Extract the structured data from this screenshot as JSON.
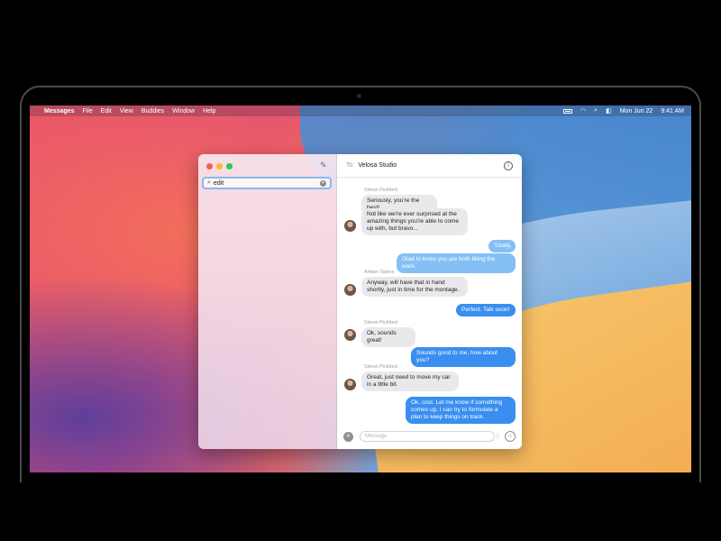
{
  "menubar": {
    "app": "Messages",
    "items": [
      "File",
      "Edit",
      "View",
      "Buddies",
      "Window",
      "Help"
    ],
    "date": "Mon Jun 22",
    "time": "9:41 AM"
  },
  "sidebar": {
    "search_value": "edit"
  },
  "chat": {
    "to_label": "To:",
    "recipient": "Velosa Studio",
    "placeholder": "Message",
    "messages": [
      {
        "sender": "Simon Pickford",
        "text": "Seriously, you're the best!"
      },
      {
        "text": "Not like we're ever surprised at the amazing things you're able to come up with, but bravo..."
      },
      {
        "text": "Totally."
      },
      {
        "text": "Glad to know you are both liking the work."
      },
      {
        "sender": "Amber Spiers",
        "text": "Anyway, will have that in hand shortly, just in time for the montage."
      },
      {
        "text": "Perfect. Talk soon!"
      },
      {
        "sender": "Simon Pickford",
        "text": "Ok, sounds great!"
      },
      {
        "text": "Sounds good to me, how about you?"
      },
      {
        "sender": "Simon Pickford",
        "text": "Great, just need to move my car in a little bit."
      },
      {
        "text": "Ok, cool. Let me know if something comes up, I can try to formulate a plan to keep things on track."
      }
    ]
  },
  "colors": {
    "accent_blue": "#3a8ef0",
    "light_blue": "#84c0f5",
    "incoming_gray": "#e9e9eb"
  },
  "icons": [
    "apple-icon",
    "battery-icon",
    "wifi-icon",
    "search-icon",
    "control-center-icon",
    "compose-icon",
    "clear-icon",
    "info-icon",
    "app-store-icon",
    "audio-wave-icon",
    "emoji-icon"
  ]
}
